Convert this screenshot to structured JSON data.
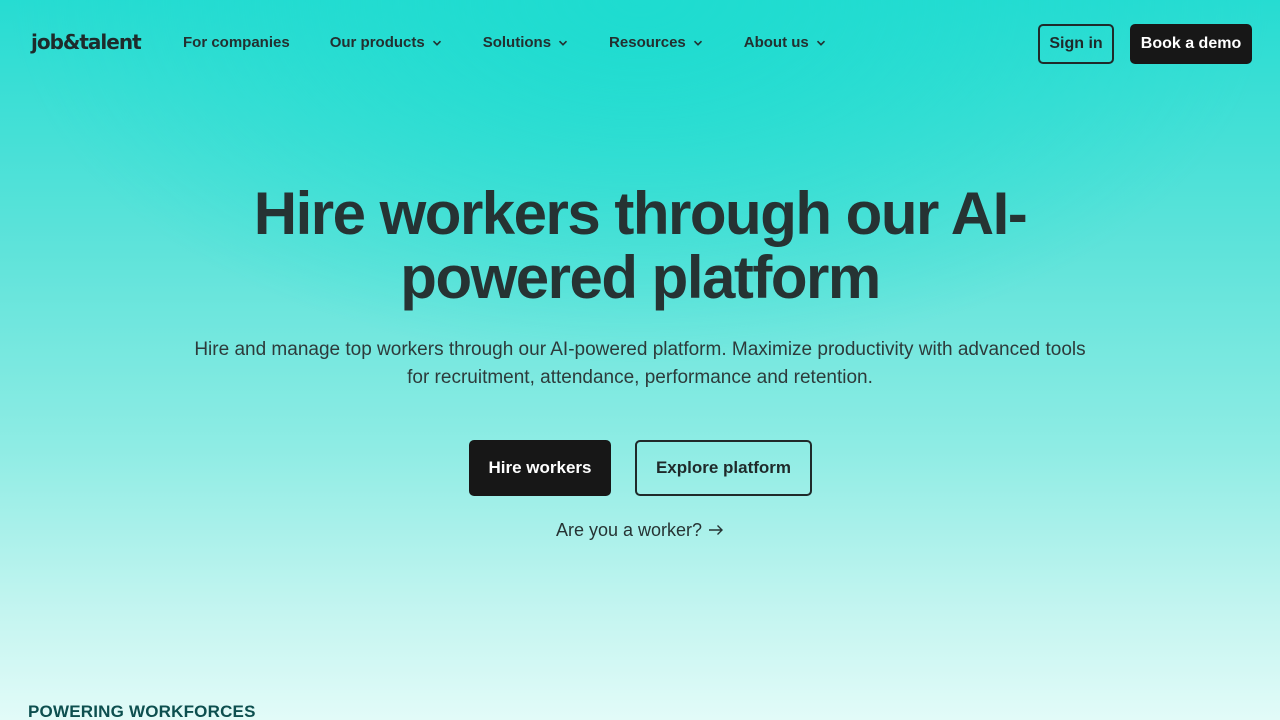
{
  "brand": {
    "logo_text": "job&talent"
  },
  "nav": {
    "items": [
      {
        "label": "For companies",
        "has_dropdown": false
      },
      {
        "label": "Our products",
        "has_dropdown": true
      },
      {
        "label": "Solutions",
        "has_dropdown": true
      },
      {
        "label": "Resources",
        "has_dropdown": true
      },
      {
        "label": "About us",
        "has_dropdown": true
      }
    ],
    "sign_in_label": "Sign in",
    "book_demo_label": "Book a demo"
  },
  "hero": {
    "title": "Hire workers through our AI-powered platform",
    "subtitle": "Hire and manage top workers through our AI-powered platform. Maximize productivity with advanced tools for recruitment, attendance, performance and retention.",
    "primary_cta": "Hire workers",
    "secondary_cta": "Explore platform",
    "worker_link": "Are you a worker?",
    "worker_link_icon": "arrow-right-icon"
  },
  "section": {
    "eyebrow": "POWERING WORKFORCES"
  },
  "colors": {
    "accent_teal": "#26dcd2",
    "dark_button": "#171717",
    "text_dark": "#263333",
    "eyebrow_text": "#0d4f4f"
  }
}
